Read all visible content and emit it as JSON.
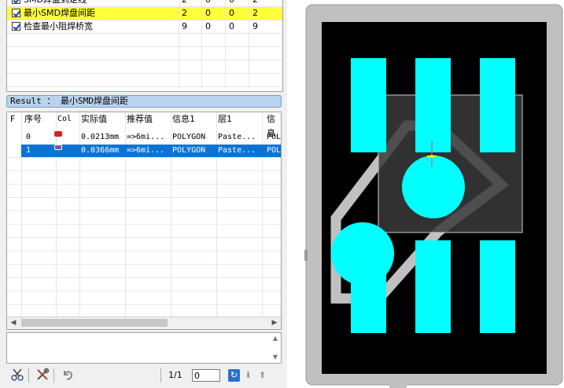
{
  "checklist": {
    "rows": [
      {
        "label": "SMD焊盘到走线",
        "v1": "2",
        "v2": "0",
        "v3": "0",
        "v4": "2",
        "checked": true,
        "highlight": false
      },
      {
        "label": "最小SMD焊盘间距",
        "v1": "2",
        "v2": "0",
        "v3": "0",
        "v4": "2",
        "checked": true,
        "highlight": true
      },
      {
        "label": "检查最小阻焊桥宽",
        "v1": "9",
        "v2": "0",
        "v3": "0",
        "v4": "9",
        "checked": true,
        "highlight": false
      }
    ]
  },
  "result": {
    "label": "Result ： 最小SMD焊盘间距"
  },
  "grid": {
    "headers": [
      "F",
      "序号",
      "Col",
      "实际值",
      "推荐值",
      "信息1",
      "层1",
      "信息"
    ],
    "rows": [
      {
        "index": "0",
        "color": "#e02020",
        "actual": "0.0213mm",
        "recommended": "=>6mi...",
        "info1": "POLYGON",
        "layer1": "Paste...",
        "info2": "POLY",
        "selected": false
      },
      {
        "index": "1",
        "color": "#7a5aa0",
        "actual": "0.0366mm",
        "recommended": "=>6mi...",
        "info1": "POLYGON",
        "layer1": "Paste...",
        "info2": "POLY",
        "selected": true
      }
    ]
  },
  "toolbar": {
    "page_label": "1/1",
    "page_value": "0",
    "icons": [
      "scissors-icon",
      "tools-icon",
      "undo-icon"
    ]
  },
  "pcb": {
    "background": "#000000",
    "outline": "#c0c0c0",
    "pad_color": "#00ffff",
    "highlight": "#ffff00"
  }
}
